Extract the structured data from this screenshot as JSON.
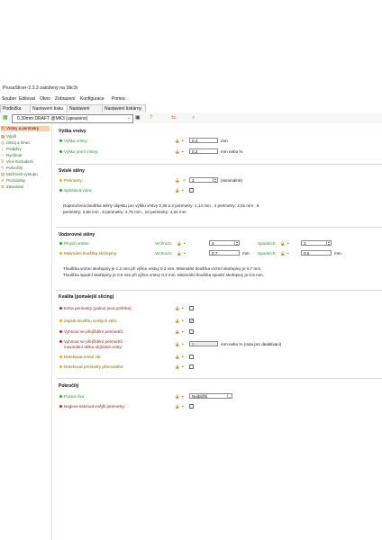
{
  "window": {
    "title": "PrusaSlicer-2.3.3 založený na Slic3r"
  },
  "menu": [
    "Soubor",
    "Editovat",
    "Okno",
    "Zobrazení",
    "Konfigurace",
    "Pomoc"
  ],
  "tabs": [
    "Podložka",
    "Nastavení tisku",
    "Nastavení filamentu",
    "Nastavení tiskárny"
  ],
  "profile": {
    "value": "0.30mm DRAFT @MK3 (upraveno)"
  },
  "sidebar": {
    "items": [
      "Vrstvy a perimetry",
      "Výplň",
      "Okraj a límec",
      "Podpěry",
      "Rychlost",
      "Více Extruderů",
      "Pokročilý",
      "Možnosti výstupu",
      "Poznámky",
      "Závislosti"
    ]
  },
  "layer_height": {
    "title": "Výška vrstvy",
    "height_label": "Výška vrstvy:",
    "height_value": "0.3",
    "height_unit": "mm",
    "first_label": "Výška první vrstvy:",
    "first_value": "0.2",
    "first_unit": "mm nebo %"
  },
  "vertical_shells": {
    "title": "Svislé stěny",
    "perimeters_label": "Perimetry:",
    "perimeters_value": "2",
    "perimeters_unit": "(minimálně)",
    "spiral_label": "Spirálová váza:",
    "note_line1": "Doporučená tloušťka stěny objektu pro výšku vrstvy 0,30 a 2 perimetry: 1,14 mm , 4 perimetry: 2,01 mm , 6",
    "note_line2": "perimetry: 2,88 mm , 8 perimetry: 3,75 mm , 10 perimetry: 4,62 mm"
  },
  "horizontal_shells": {
    "title": "Vodorovné stěny",
    "solid_label": "Plných vrstev:",
    "top_label": "Vrchních:",
    "top_value": "4",
    "bottom_label": "Spodních:",
    "bottom_value": "3",
    "min_label": "Minimální tloušťka skořepiny:",
    "min_top_label": "Vrchních:",
    "min_top_value": "0.7",
    "min_top_unit": "mm",
    "min_bottom_label": "Spodních:",
    "min_bottom_value": "0.5",
    "min_bottom_unit": "mm",
    "note_line1": "Tloušťka vrchní skořepiny je 1.2 mm při výšce vrstvy 0.3 mm. Minimální tloušťka vrchní skořepiny je 0.7 mm.",
    "note_line2": "Tloušťka spodní skořepiny je 0.9 mm při výšce vrstvy 0.3 mm. Minimální tloušťka spodní skořepiny je 0.5 mm."
  },
  "quality": {
    "title": "Kvalita (pomalejší slicing)",
    "extra_label": "Extra perimetry (pokud jsou potřeba):",
    "thin_label": "Zajistit tloušťku svislých stěn:",
    "avoid_label": "Vyhnout se přejíždění perimetrů:",
    "avoid_max_label1": "Vyhnout se přejíždění perimetrů -",
    "avoid_max_label2": "maximální délka objízdné cesty:",
    "avoid_max_value": "0",
    "avoid_max_unit": "mm nebo % (nula pro deaktivaci)",
    "thin_walls_label": "Detekovat tenké zdi:",
    "overhang_label": "Detekovat perimetry přemostění:"
  },
  "advanced": {
    "title": "Pokročilý",
    "seam_label": "Pozice švu:",
    "seam_value": "Nejbližší",
    "external_label": "Nejprve tisknout vnější perimetry:"
  },
  "colors": {
    "accent_orange": "#e0661a",
    "simple_green": "#2ea82e",
    "expert_red": "#c62828",
    "advanced_yellow": "#e6b800",
    "selected_bg": "#ffd0b0"
  }
}
